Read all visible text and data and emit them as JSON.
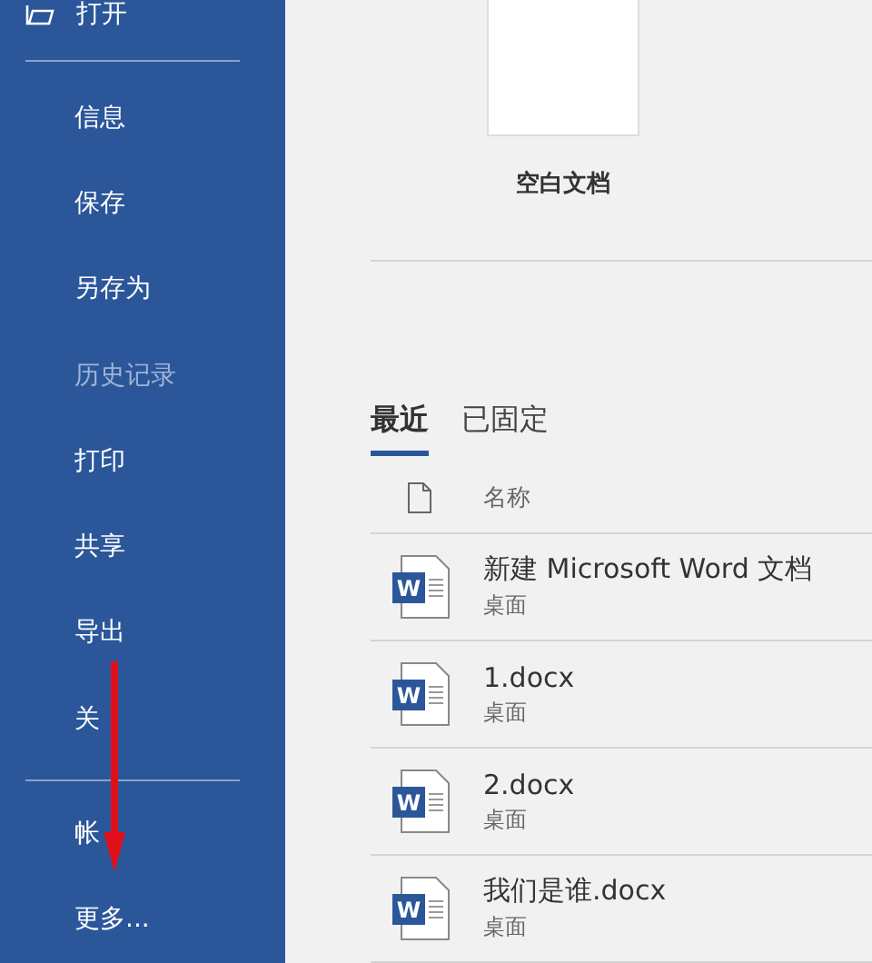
{
  "sidebar": {
    "top_item": {
      "label": "打开"
    },
    "items": [
      {
        "label": "信息",
        "disabled": false
      },
      {
        "label": "保存",
        "disabled": false
      },
      {
        "label": "另存为",
        "disabled": false
      },
      {
        "label": "历史记录",
        "disabled": true
      },
      {
        "label": "打印",
        "disabled": false
      },
      {
        "label": "共享",
        "disabled": false
      },
      {
        "label": "导出",
        "disabled": false
      },
      {
        "label": "关",
        "disabled": false
      }
    ],
    "bottom_items": [
      {
        "label": "帐"
      },
      {
        "label": "更多..."
      }
    ]
  },
  "templates": [
    {
      "label": "空白文档"
    }
  ],
  "tabs": [
    {
      "label": "最近",
      "selected": true
    },
    {
      "label": "已固定",
      "selected": false
    }
  ],
  "file_list": {
    "column": "名称",
    "rows": [
      {
        "icon_label": "W",
        "name": "新建 Microsoft Word 文档",
        "location": "桌面"
      },
      {
        "icon_label": "W",
        "name": "1.docx",
        "location": "桌面"
      },
      {
        "icon_label": "W",
        "name": "2.docx",
        "location": "桌面"
      },
      {
        "icon_label": "W",
        "name": "我们是谁.docx",
        "location": "桌面"
      }
    ]
  }
}
